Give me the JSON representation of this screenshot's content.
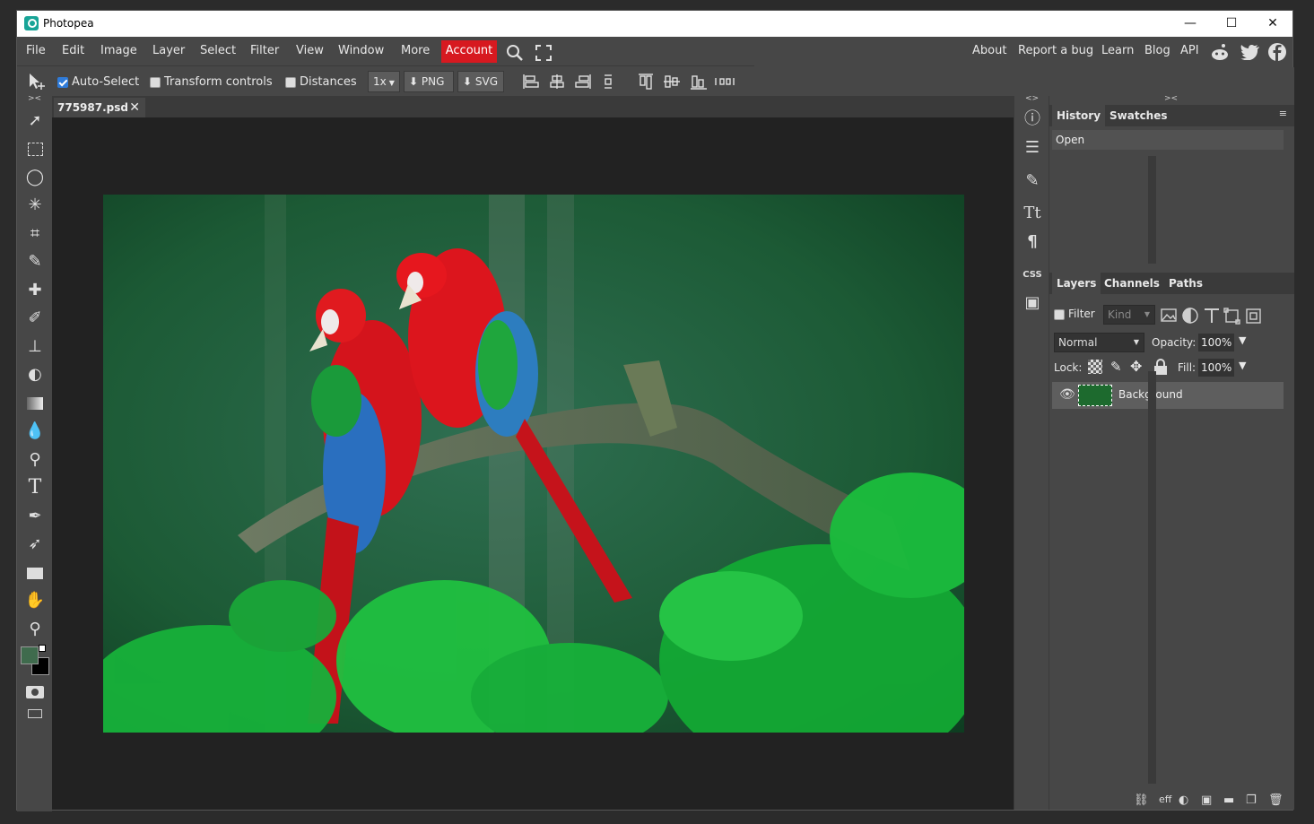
{
  "app": {
    "title": "Photopea"
  },
  "window_controls": {
    "minimize": "—",
    "maximize": "☐",
    "close": "✕"
  },
  "menu": {
    "left": [
      "File",
      "Edit",
      "Image",
      "Layer",
      "Select",
      "Filter",
      "View",
      "Window",
      "More"
    ],
    "account": "Account",
    "right": [
      "About",
      "Report a bug",
      "Learn",
      "Blog",
      "API"
    ]
  },
  "options": {
    "auto_select": "Auto-Select",
    "transform_controls": "Transform controls",
    "distances": "Distances",
    "zoom": "1x",
    "png": "PNG",
    "svg": "SVG"
  },
  "document": {
    "tab_name": "775987.psd"
  },
  "panels": {
    "top_tabs": [
      "History",
      "Swatches"
    ],
    "history_items": [
      "Open"
    ],
    "bottom_tabs": [
      "Layers",
      "Channels",
      "Paths"
    ],
    "filter_label": "Filter",
    "kind_placeholder": "Kind",
    "blend_mode": "Normal",
    "opacity_label": "Opacity:",
    "opacity_value": "100%",
    "lock_label": "Lock:",
    "fill_label": "Fill:",
    "fill_value": "100%",
    "layers": [
      {
        "name": "Background"
      }
    ],
    "eff_label": "eff",
    "css_label": "CSS"
  },
  "colors": {
    "accent": "#d71920",
    "fg_swatch": "#3f6b4d",
    "bg_swatch": "#000000"
  }
}
